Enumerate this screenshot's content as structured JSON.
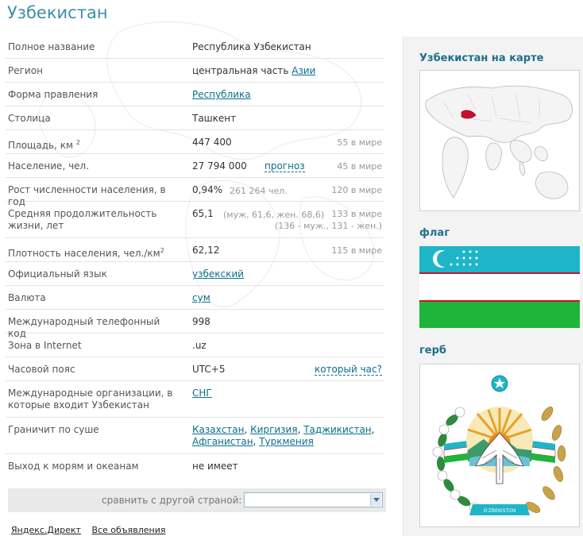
{
  "page": {
    "title": "Узбекистан"
  },
  "rows": [
    {
      "label": "Полное название",
      "value": "Республика Узбекистан"
    },
    {
      "label": "Регион",
      "value_prefix": "центральная часть ",
      "value_link": "Азии"
    },
    {
      "label": "Форма правления",
      "value_link": "Республика"
    },
    {
      "label": "Столица",
      "value": "Ташкент"
    },
    {
      "label": "Площадь, км",
      "label_sup": "2",
      "value": "447 400",
      "rank": "55 в мире"
    },
    {
      "label": "Население, чел.",
      "value": "27 794 000",
      "link": "прогноз",
      "rank": "45 в мире"
    },
    {
      "label": "Рост численности населения, в год",
      "value": "0,94%",
      "extra": "261 264 чел.",
      "rank": "120 в мире"
    },
    {
      "label": "Средняя продолжительность жизни, лет",
      "value": "65,1",
      "extra": "(муж. 61,6, жен. 68,6)",
      "rank": "133 в мире",
      "rank2": "(136 - муж., 131 - жен.)"
    },
    {
      "label": "Плотность населения, чел./км",
      "label_sup": "2",
      "value": "62,12",
      "rank": "115 в мире"
    },
    {
      "label": "Официальный язык",
      "value_link": "узбекский"
    },
    {
      "label": "Валюта",
      "value_link": "сум"
    },
    {
      "label": "Международный телефонный код",
      "value": "998"
    },
    {
      "label": "Зона в Internet",
      "value": ".uz"
    },
    {
      "label": "Часовой пояс",
      "value": "UTC+5",
      "link": "который час?"
    },
    {
      "label": "Международные организации, в которые входит Узбекистан",
      "value_link": "СНГ"
    },
    {
      "label": "Граничит по суше",
      "borders": [
        "Казахстан",
        "Киргизия",
        "Таджикистан",
        "Афганистан",
        "Туркмения"
      ]
    },
    {
      "label": "Выход к морям и океанам",
      "value": "не имеет"
    }
  ],
  "compare": {
    "label": "сравнить с другой страной:",
    "selected": ""
  },
  "footer": {
    "links": [
      "Яндекс.Директ",
      "Все объявления"
    ]
  },
  "sidebar": {
    "map_title": "Узбекистан на карте",
    "flag_title": "флаг",
    "emblem_title": "герб",
    "emblem_banner": "O'ZBEKISTON"
  },
  "colors": {
    "title": "#3a8fa6",
    "link": "#0b6e8c",
    "flag_blue": "#1eb5c9",
    "flag_red": "#ce1126",
    "flag_green": "#1eb53a",
    "map_highlight": "#c8102e"
  }
}
